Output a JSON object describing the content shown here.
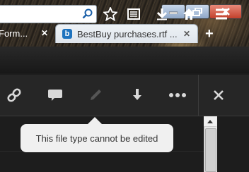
{
  "browser": {
    "tabs": [
      {
        "label": "Form...",
        "active": false
      },
      {
        "label": "BestBuy purchases.rtf ...",
        "active": true
      }
    ],
    "tab_close_glyph": "✕",
    "new_tab_glyph": "+",
    "address_value": "",
    "nav_icons": [
      "search-icon",
      "star-icon",
      "reading-list-icon",
      "download-icon",
      "home-icon",
      "menu-icon"
    ],
    "window_controls": [
      "minimize-icon",
      "maximize-icon",
      "close-icon"
    ]
  },
  "toolbar": {
    "buttons": [
      "link-icon",
      "comment-icon",
      "edit-pencil-icon",
      "download-icon",
      "more-icon",
      "close-icon"
    ],
    "edit_disabled": true
  },
  "tooltip": {
    "text": "This file type cannot be edited"
  },
  "colors": {
    "toolbar_bg": "#262626",
    "tooltip_bg": "#f0f0f0",
    "favicon_blue": "#1e73be"
  }
}
